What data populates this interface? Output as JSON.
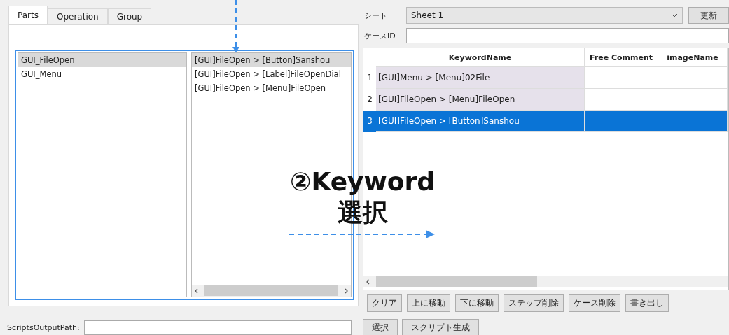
{
  "tabs": [
    {
      "label": "Parts",
      "selected": true
    },
    {
      "label": "Operation",
      "selected": false
    },
    {
      "label": "Group",
      "selected": false
    }
  ],
  "parts_list": [
    {
      "label": "GUI_FileOpen",
      "selected": true
    },
    {
      "label": "GUI_Menu",
      "selected": false
    }
  ],
  "keyword_list": [
    {
      "label": "[GUI]FileOpen > [Button]Sanshou",
      "selected": true
    },
    {
      "label": "[GUI]FileOpen > [Label]FileOpenDial",
      "selected": false
    },
    {
      "label": "[GUI]FileOpen > [Menu]FileOpen",
      "selected": false
    }
  ],
  "sheet": {
    "label": "シート",
    "value": "Sheet 1",
    "button": "更新"
  },
  "case_id": {
    "label": "ケースID"
  },
  "table": {
    "columns": [
      "KeywordName",
      "Free Comment",
      "imageName"
    ],
    "rows": [
      {
        "number": "1",
        "keyword": "[GUI]Menu > [Menu]02File",
        "selected": false
      },
      {
        "number": "2",
        "keyword": "[GUI]FileOpen > [Menu]FileOpen",
        "selected": false
      },
      {
        "number": "3",
        "keyword": "[GUI]FileOpen > [Button]Sanshou",
        "selected": true
      }
    ]
  },
  "table_buttons": [
    "クリア",
    "上に移動",
    "下に移動",
    "ステップ削除",
    "ケース削除",
    "書き出し"
  ],
  "output": {
    "label": "ScriptsOutputPath:",
    "buttons": [
      "選択",
      "スクリプト生成"
    ]
  },
  "annotation": {
    "lines": [
      "②Keyword",
      "選択"
    ]
  }
}
